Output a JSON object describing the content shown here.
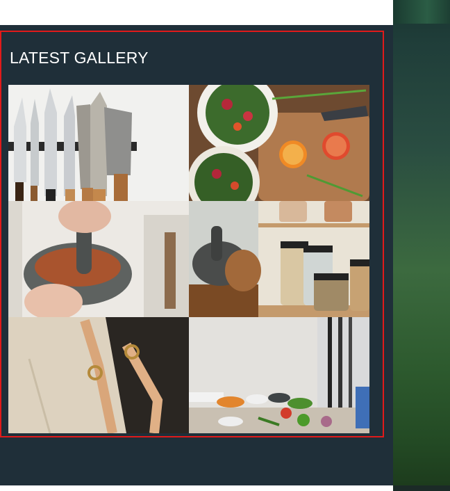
{
  "widget": {
    "title": "LATEST GALLERY"
  },
  "gallery": {
    "items": [
      {
        "icon": "knives-photo"
      },
      {
        "icon": "salad-photo"
      },
      {
        "icon": "mortar-photo"
      },
      {
        "icon": "jars-photo"
      },
      {
        "icon": "apron-photo"
      },
      {
        "icon": "kitchen-counter-photo"
      }
    ]
  },
  "colors": {
    "panel": "#1f2f39",
    "highlight_border": "#e11a1a",
    "title": "#ffffff"
  }
}
